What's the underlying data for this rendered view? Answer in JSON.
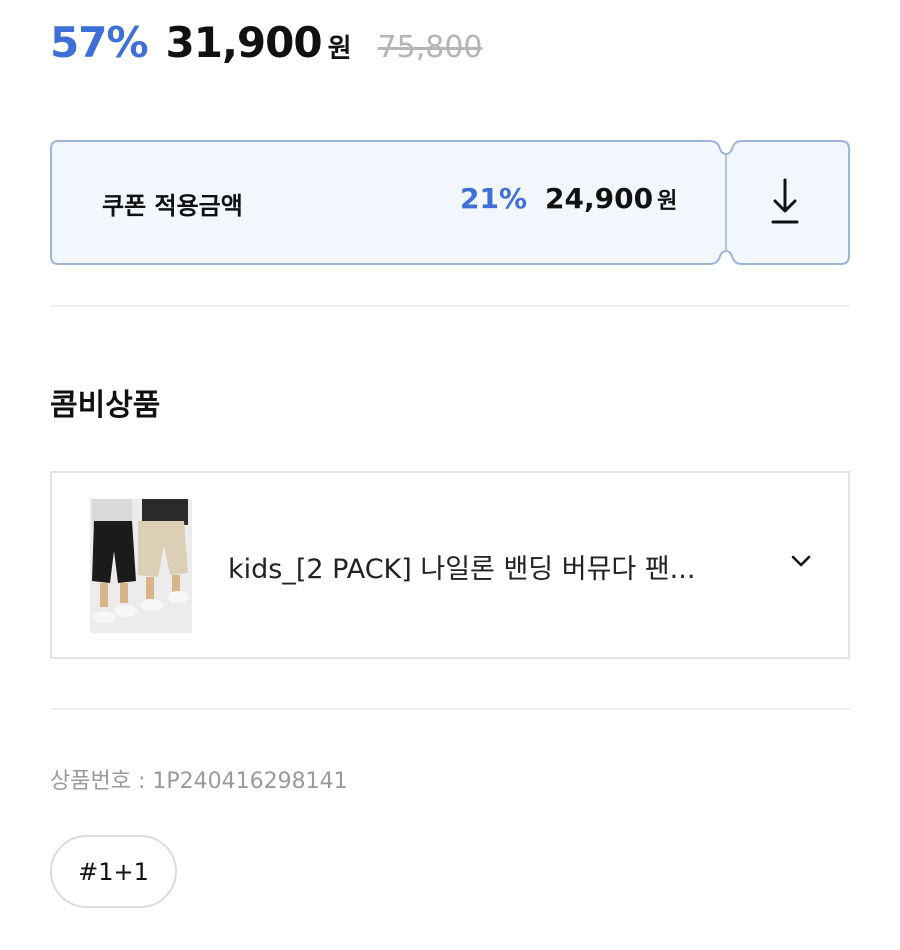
{
  "price": {
    "discount": "57%",
    "sale_price": "31,900",
    "currency": "원",
    "original_price": "75,800"
  },
  "coupon": {
    "label": "쿠폰 적용금액",
    "discount": "21%",
    "price": "24,900",
    "currency": "원",
    "download_icon": "download-arrow-icon",
    "accent_color": "#3d6fd6",
    "background_color": "#f2f6fd",
    "border_color": "#9cb3dc"
  },
  "combo": {
    "title": "콤비상품",
    "item_name": "kids_[2 PACK] 나일론 밴딩 버뮤다 팬...",
    "expand_icon": "chevron-down-icon"
  },
  "product_number": {
    "label": "상품번호 : ",
    "value": "1P240416298141"
  },
  "tags": [
    "#1+1"
  ]
}
